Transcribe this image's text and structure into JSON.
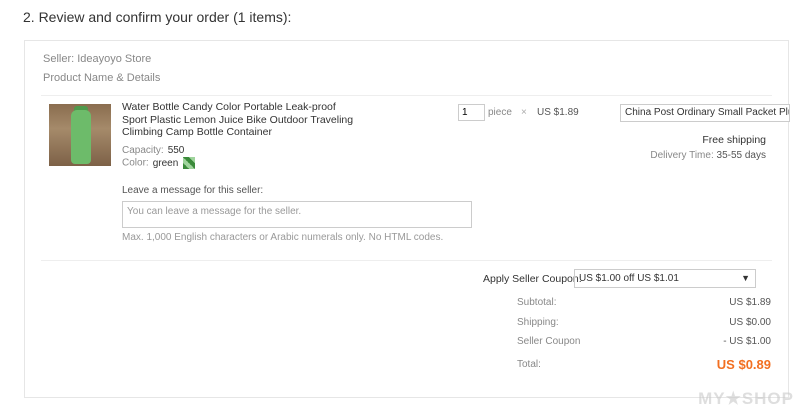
{
  "step_title": "2. Review and confirm your order (1 items):",
  "seller": "Seller: Ideayoyo Store",
  "product_header": "Product Name & Details",
  "product": {
    "title": "Water Bottle Candy Color Portable Leak-proof Sport Plastic Lemon Juice Bike Outdoor Traveling Climbing Camp Bottle Container",
    "capacity_label": "Capacity:",
    "capacity_value": "550",
    "color_label": "Color:",
    "color_value": "green"
  },
  "quantity": {
    "value": "1",
    "unit": "piece",
    "times": "×",
    "unit_price": "US $1.89"
  },
  "shipping": {
    "method": "China Post Ordinary Small Packet Plus",
    "free_shipping": "Free shipping",
    "delivery_label": "Delivery Time:",
    "delivery_value": "35-55 days"
  },
  "message": {
    "label": "Leave a message for this seller:",
    "placeholder": "You can leave a message for the seller.",
    "hint": "Max. 1,000 English characters or Arabic numerals only. No HTML codes."
  },
  "coupon": {
    "label": "Apply Seller Coupon:",
    "selected": "US $1.00 off US $1.01"
  },
  "summary": {
    "subtotal_label": "Subtotal:",
    "subtotal_value": "US $1.89",
    "shipping_label": "Shipping:",
    "shipping_value": "US $0.00",
    "coupon_label": "Seller Coupon",
    "coupon_value": "- US $1.00",
    "total_label": "Total:",
    "total_value": "US $0.89"
  },
  "watermark": "MY★SHOP",
  "colors": {
    "accent_total": "#f26f21",
    "border": "#e6e6e6"
  }
}
